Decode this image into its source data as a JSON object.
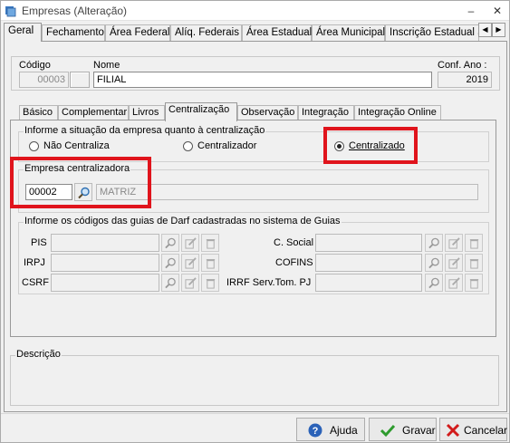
{
  "window": {
    "title": "Empresas (Alteração)"
  },
  "titlebar": {
    "minimize": "–",
    "close": "✕"
  },
  "top_tabs": [
    "Geral",
    "Fechamento",
    "Área Federal",
    "Alíq. Federais",
    "Área Estadual",
    "Área Municipal",
    "Inscrição Estadual S"
  ],
  "top_tab_active": "Geral",
  "header": {
    "codigo_label": "Código",
    "codigo_value": "00003",
    "nome_label": "Nome",
    "nome_value": "FILIAL",
    "conf_ano_label": "Conf. Ano :",
    "conf_ano_value": "2019"
  },
  "inner_tabs": [
    "Básico",
    "Complementar",
    "Livros",
    "Centralização",
    "Observação",
    "Integração",
    "Integração Online"
  ],
  "inner_tab_active": "Centralização",
  "centralizacao": {
    "group_title": "Informe a situação da empresa quanto à centralização",
    "options": [
      "Não Centraliza",
      "Centralizador",
      "Centralizado"
    ],
    "selected": "Centralizado"
  },
  "empresa_centralizadora": {
    "group_title": "Empresa centralizadora",
    "codigo": "00002",
    "nome": "MATRIZ"
  },
  "guias": {
    "group_title": "Informe os códigos das guias de Darf cadastradas no sistema de Guias",
    "left_labels": [
      "PIS",
      "IRPJ",
      "CSRF"
    ],
    "right_labels": [
      "C. Social",
      "COFINS",
      "IRRF Serv.Tom. PJ"
    ]
  },
  "descricao": {
    "group_title": "Descrição"
  },
  "actions": {
    "help": "Ajuda",
    "save": "Gravar",
    "cancel": "Cancelar"
  },
  "colors": {
    "highlight": "#e0141c"
  }
}
